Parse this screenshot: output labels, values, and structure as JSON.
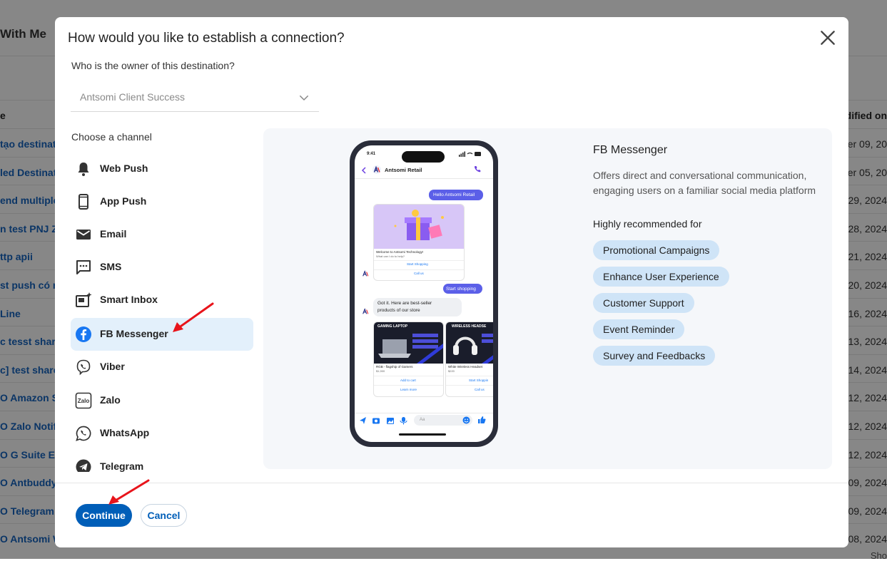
{
  "background": {
    "title_fragment": "With Me",
    "col_left_header": "e",
    "col_right_header": "dified on",
    "rows": [
      {
        "left": "tạo destinati",
        "right": "ber 09, 20"
      },
      {
        "left": "led Destinati",
        "right": "ber 05, 20"
      },
      {
        "left": "end multiple",
        "right": "29, 2024"
      },
      {
        "left": "n test PNJ ZN",
        "right": "28, 2024"
      },
      {
        "left": "ttp apii",
        "right": "21, 2024"
      },
      {
        "left": "st push có ra",
        "right": "20, 2024"
      },
      {
        "left": "Line",
        "right": "16, 2024"
      },
      {
        "left": "c tesst share",
        "right": "13, 2024"
      },
      {
        "left": "c] test share",
        "right": "14, 2024"
      },
      {
        "left": "O Amazon SE",
        "right": "12, 2024"
      },
      {
        "left": "O Zalo Notifi",
        "right": "12, 2024"
      },
      {
        "left": "O G Suite Em",
        "right": "12, 2024"
      },
      {
        "left": "O Antbuddy w",
        "right": "09, 2024"
      },
      {
        "left": "O Telegram D",
        "right": "09, 2024"
      },
      {
        "left": "O Antsomi W",
        "right": "08, 2024"
      }
    ],
    "bottom_fragment": "Sho"
  },
  "modal": {
    "title": "How would you like to establish a connection?",
    "owner_label": "Who is the owner of this destination?",
    "owner_value": "Antsomi Client Success",
    "channel_label": "Choose a channel",
    "channels": [
      {
        "label": "Web Push",
        "icon": "bell-icon"
      },
      {
        "label": "App Push",
        "icon": "mobile-icon"
      },
      {
        "label": "Email",
        "icon": "envelope-icon"
      },
      {
        "label": "SMS",
        "icon": "sms-icon"
      },
      {
        "label": "Smart Inbox",
        "icon": "smart-inbox-icon"
      },
      {
        "label": "FB Messenger",
        "icon": "facebook-icon",
        "selected": true
      },
      {
        "label": "Viber",
        "icon": "viber-icon"
      },
      {
        "label": "Zalo",
        "icon": "zalo-icon"
      },
      {
        "label": "WhatsApp",
        "icon": "whatsapp-icon"
      },
      {
        "label": "Telegram",
        "icon": "telegram-icon"
      }
    ],
    "preview": {
      "title": "FB Messenger",
      "description": "Offers direct and conversational communication, engaging users on a familiar social media platform",
      "recommended_label": "Highly recommended for",
      "tags": [
        "Promotional Campaigns",
        "Enhance User Experience",
        "Customer Support",
        "Event Reminder",
        "Survey and Feedbacks"
      ],
      "phone": {
        "time": "9:41",
        "contact": "Antsomi Retail",
        "msg_hello": "Hello Antsomi Retail",
        "card_title": "Welcome to Antsomi Technology!",
        "card_sub": "What can I do to help?",
        "card_btn1": "Start Shopping",
        "card_btn2": "Call us",
        "msg_start": "Start shopping",
        "msg_reply_1": "Got it. Here are best-seller",
        "msg_reply_2": "products of our store",
        "prod1_banner": "GAMING LAPTOP",
        "prod1_name": "RGB - flagship of Gamers",
        "prod1_price": "$1,900",
        "prod1_btn1": "Add to cart",
        "prod1_btn2": "Learn more",
        "prod2_banner": "WIRELESS HEADSE",
        "prod2_name": "White Wireless Headset",
        "prod2_price": "$220",
        "prod2_btn1": "Start Shoppin",
        "prod2_btn2": "Call us",
        "input_placeholder": "Aa"
      }
    },
    "buttons": {
      "continue": "Continue",
      "cancel": "Cancel"
    }
  },
  "colors": {
    "primary": "#005eb8",
    "selected_bg": "#e3f0fb",
    "tag_bg": "#cfe4f7",
    "messenger_bubble": "#5b5fe8",
    "annotation_arrow": "#e8141b"
  }
}
